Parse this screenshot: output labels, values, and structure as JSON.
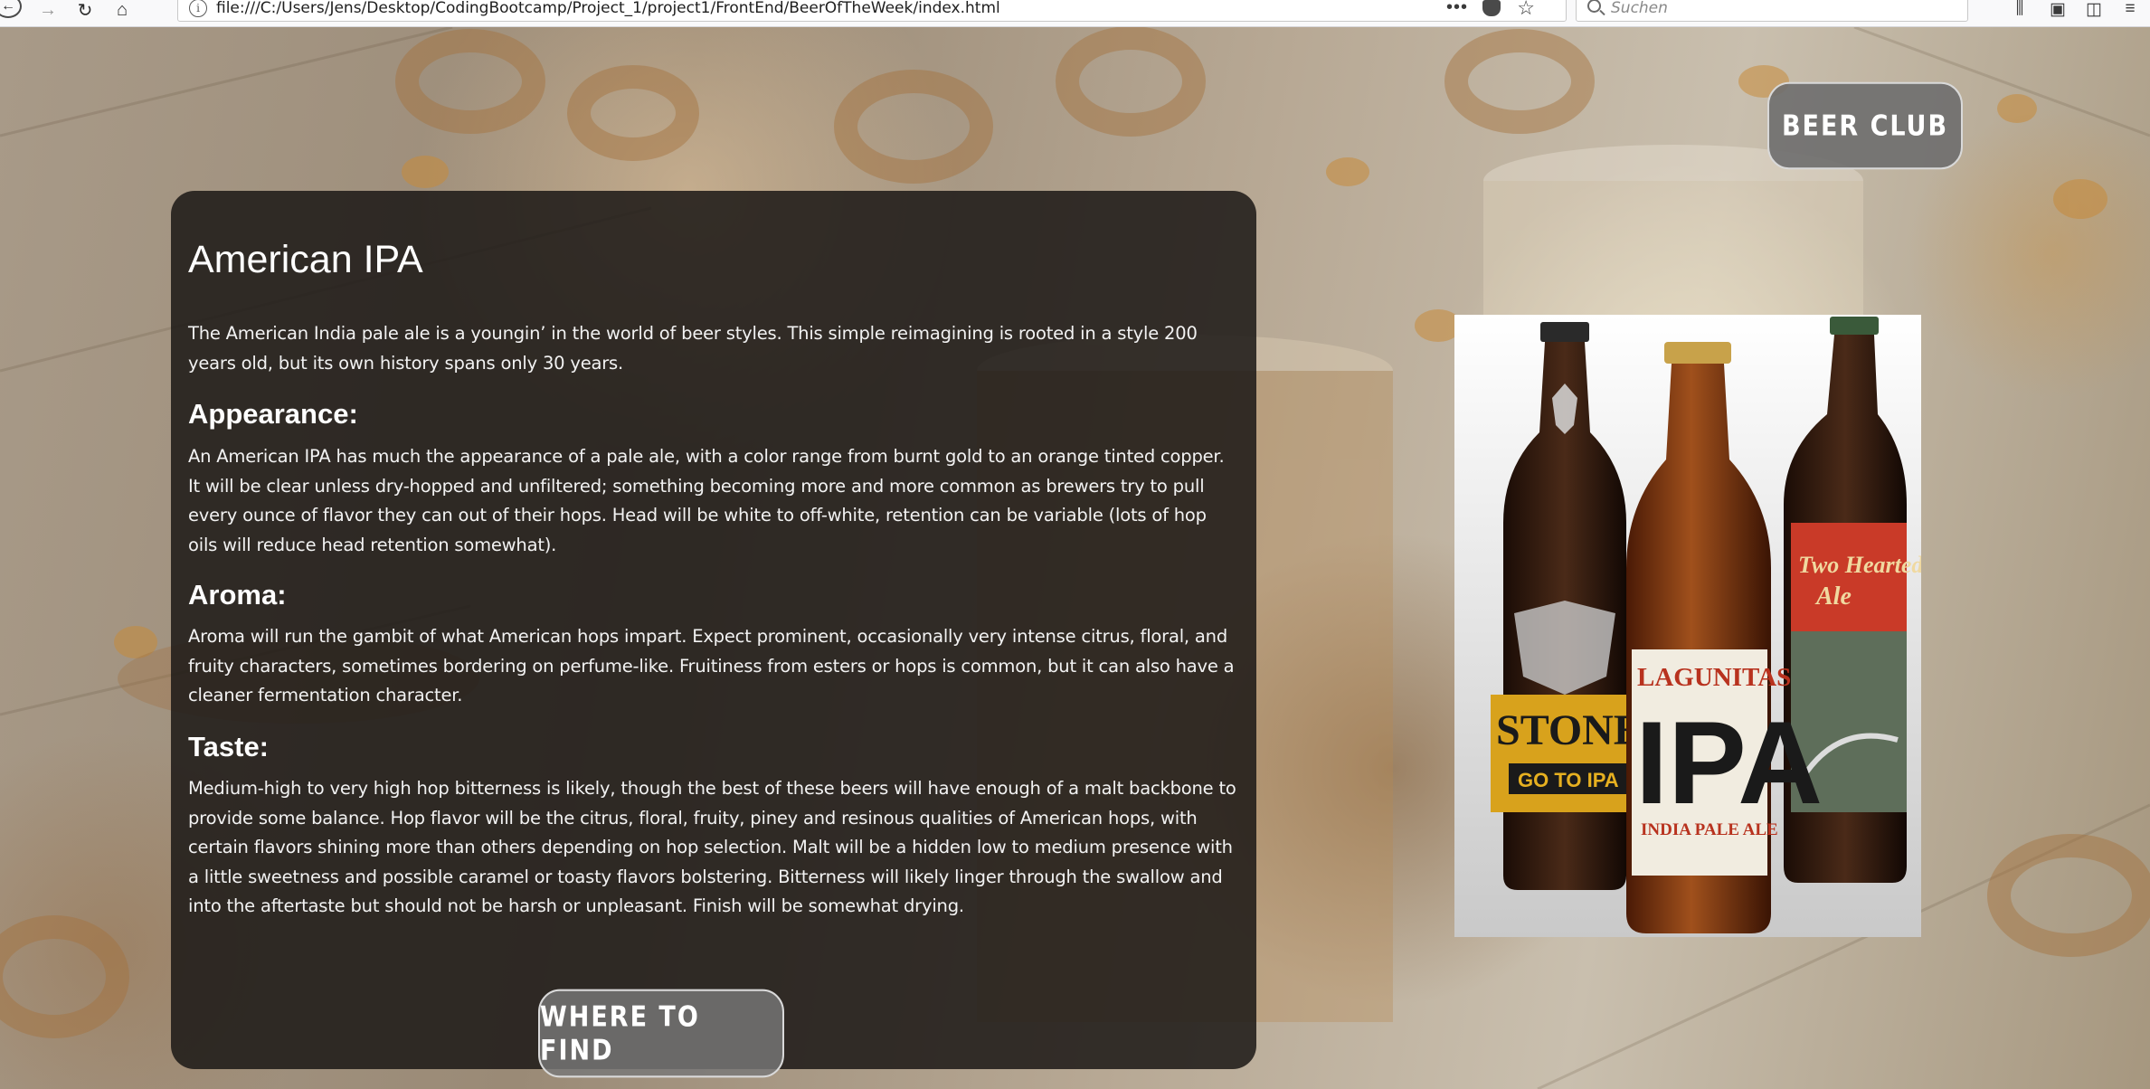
{
  "browser": {
    "url": "file:///C:/Users/Jens/Desktop/CodingBootcamp/Project_1/project1/FrontEnd/BeerOfTheWeek/index.html",
    "search_placeholder": "Suchen",
    "icons": [
      "back-icon",
      "forward-icon",
      "reload-icon",
      "home-icon",
      "info-icon",
      "page-actions-icon",
      "pocket-icon",
      "bookmark-star-icon",
      "search-icon",
      "library-icon",
      "bookmarks-icon",
      "sidebar-icon",
      "menu-icon"
    ]
  },
  "header": {
    "club_button": "BEER CLUB"
  },
  "beer": {
    "title": "American IPA",
    "intro": "The American India pale ale is a youngin’ in the world of beer styles. This simple reimagining is rooted in a style 200 years old, but its own history spans only 30 years.",
    "sections": [
      {
        "heading": "Appearance:",
        "text": "An American IPA has much the appearance of a pale ale, with a color range from burnt gold to an orange tinted copper. It will be clear unless dry-hopped and unfiltered; something becoming more and more common as brewers try to pull every ounce of flavor they can out of their hops. Head will be white to off-white, retention can be variable (lots of hop oils will reduce head retention somewhat)."
      },
      {
        "heading": "Aroma:",
        "text": "Aroma will run the gambit of what American hops impart. Expect prominent, occasionally very intense citrus, floral, and fruity characters, sometimes bordering on perfume-like. Fruitiness from esters or hops is common, but it can also have a cleaner fermentation character."
      },
      {
        "heading": "Taste:",
        "text": "Medium-high to very high hop bitterness is likely, though the best of these beers will have enough of a malt backbone to provide some balance. Hop flavor will be the citrus, floral, fruity, piney and resinous qualities of American hops, with certain flavors shining more than others depending on hop selection. Malt will be a hidden low to medium presence with a little sweetness and possible caramel or toasty flavors bolstering. Bitterness will likely linger through the swallow and into the aftertaste but should not be harsh or unpleasant. Finish will be somewhat drying."
      }
    ],
    "find_button": "WHERE TO FIND"
  },
  "bottles_image": {
    "labels": {
      "left_brand": "STONE",
      "left_tag": "GO TO IPA",
      "center_brand": "LAGUNITAS",
      "center_style": "IPA",
      "center_sub": "INDIA PALE ALE",
      "right_name_1": "Two Hearted",
      "right_name_2": "Ale"
    }
  },
  "colors": {
    "panel": "#1c1816",
    "button": "#787878",
    "lagunitas_label": "#f1ece0",
    "amber": "#a0501c"
  }
}
